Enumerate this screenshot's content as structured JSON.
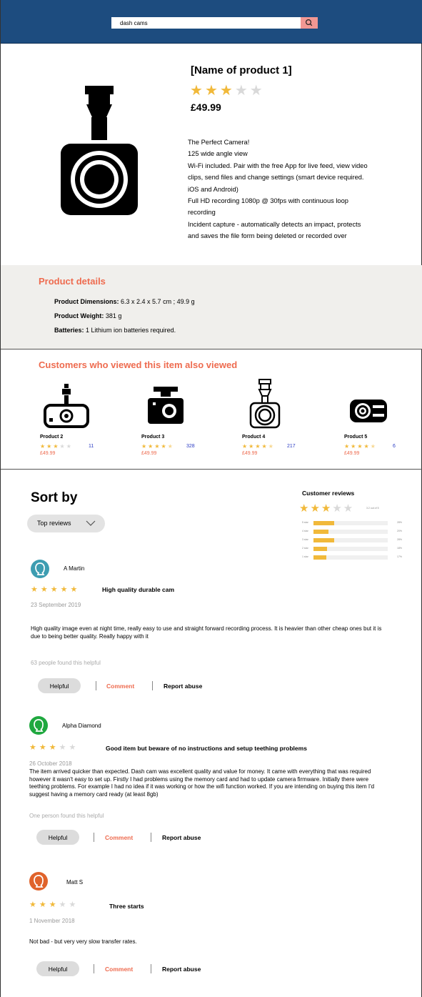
{
  "search": {
    "value": "dash cams"
  },
  "icons": {
    "search": "magnifier-icon",
    "main_product": "dash-cam-icon",
    "dropdown": "chevron-down-icon",
    "avatar": "user-avatar-icon"
  },
  "colors": {
    "header": "#1d4c7f",
    "search_button": "#f19793",
    "accent": "#ee6b4f",
    "star": "#f1b93a",
    "link": "#2b3cc4"
  },
  "product": {
    "name": "[Name of product 1]",
    "rating": 3,
    "price": "£49.99",
    "description": [
      "The Perfect Camera!",
      "125 wide angle view",
      "Wi-Fi included. Pair with the free App for live feed, view video",
      "clips, send files and change settings (smart device required.",
      "iOS and Android)",
      "Full HD recording 1080p @ 30fps with continuous loop",
      "recording",
      "Incident capture - automatically detects an impact, protects",
      "and saves the file form being deleted or recorded over"
    ]
  },
  "details": {
    "heading": "Product details",
    "items": [
      {
        "label": "Product Dimensions:",
        "value": "6.3 x 2.4 x 5.7 cm ; 49.9 g"
      },
      {
        "label": "Product Weight:",
        "value": "381 g"
      },
      {
        "label": "Batteries:",
        "value": "1 Lithium ion batteries required."
      }
    ]
  },
  "also_viewed": {
    "heading": "Customers who viewed this item also viewed",
    "products": [
      {
        "name": "Product 2",
        "rating": 3,
        "count": "11",
        "price": "£49.99"
      },
      {
        "name": "Product 3",
        "rating": 4.5,
        "count": "328",
        "price": "£49.99"
      },
      {
        "name": "Product 4",
        "rating": 4.5,
        "count": "217",
        "price": "£49.99"
      },
      {
        "name": "Product 5",
        "rating": 4.5,
        "count": "6",
        "price": "£49.99"
      }
    ]
  },
  "sort": {
    "title": "Sort by",
    "selected": "Top reviews"
  },
  "summary": {
    "title": "Customer reviews",
    "rating": 3,
    "rating_text": "3.2 out of 5",
    "bars": [
      {
        "label": "5 star",
        "fraction": 0.28,
        "pct": "28%"
      },
      {
        "label": "4 star",
        "fraction": 0.2,
        "pct": "20%"
      },
      {
        "label": "3 star",
        "fraction": 0.28,
        "pct": "28%"
      },
      {
        "label": "2 star",
        "fraction": 0.18,
        "pct": "18%"
      },
      {
        "label": "1 star",
        "fraction": 0.17,
        "pct": "17%"
      }
    ]
  },
  "reviews": [
    {
      "name": "A Martin",
      "avatar_color": "#3d9db1",
      "rating": 5,
      "title": "High quality durable cam",
      "date": "23 September 2019",
      "body": "High quality image even at night time, really easy to use and straight forward recording process. It is heavier than other cheap ones but it is due to being better quality. Really happy with it",
      "helpful": "63 people found this helpful",
      "helpful_btn": "Helpful",
      "comment": "Comment",
      "report": "Report abuse"
    },
    {
      "name": "Alpha Diamond",
      "avatar_color": "#1fa83f",
      "rating": 3,
      "title": "Good item but beware of no instructions and setup teething problems",
      "date": "26 October 2018",
      "body": "The item arrived quicker than expected. Dash cam was excellent quality and value for money. It came with everything that was required however it wasn't easy to set up. Firstly I had problems using the memory card and had to update camera firmware. Initially there were teething problems. For example I had no idea if it was working or how the wifi function worked. If you are intending on buying this item I'd suggest having a memory card ready (at least 8gb)",
      "helpful": "One person found this helpful",
      "helpful_btn": "Helpful",
      "comment": "Comment",
      "report": "Report abuse"
    },
    {
      "name": "Matt S",
      "avatar_color": "#e0632b",
      "rating": 3,
      "title": "Three starts",
      "date": "1 November 2018",
      "body": "Not bad - but very very slow transfer rates.",
      "helpful": "",
      "helpful_btn": "Helpful",
      "comment": "Comment",
      "report": "Report abuse"
    }
  ]
}
